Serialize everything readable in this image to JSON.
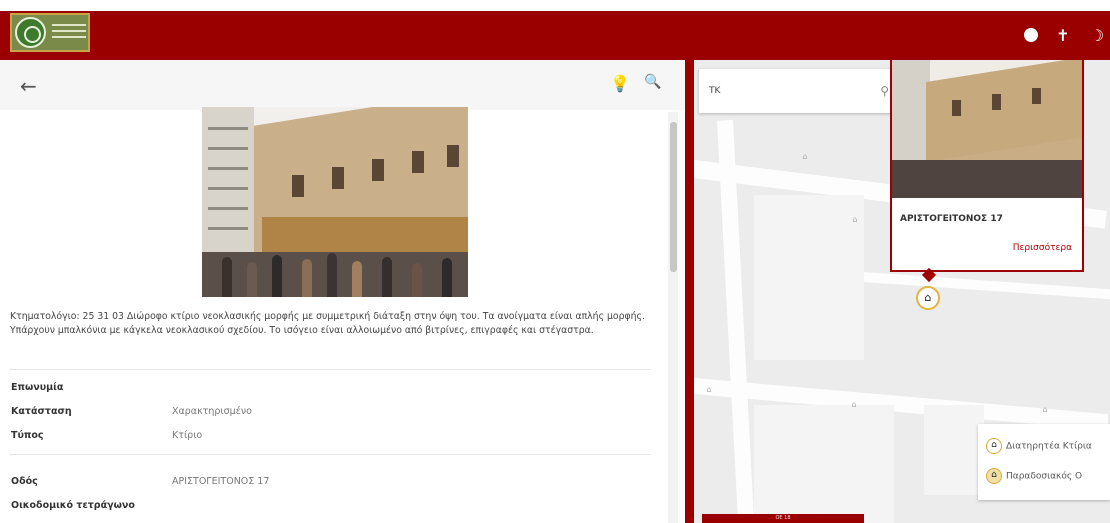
{
  "header": {
    "logo_name": "logo",
    "icons": [
      "info-icon",
      "pin-icon",
      "theme-toggle-icon"
    ],
    "brand_color": "#9b0000"
  },
  "left_panel": {
    "back_icon": "back-arrow-icon",
    "toolbar_icons": [
      "lightbulb-icon",
      "zoom-icon"
    ],
    "description": "Κτηματολόγιο: 25 31 03 Διώροφο κτίριο νεοκλασικής μορφής με συμμετρική διάταξη στην όψη του. Τα ανοίγματα είναι απλής μορφής. Υπάρχουν μπαλκόνια με κάγκελα νεοκλασικού σχεδίου. Το ισόγειο είναι αλλοιωμένο από βιτρίνες, επιγραφές και στέγαστρα.",
    "attributes_1": [
      {
        "label": "Επωνυμία",
        "value": ""
      },
      {
        "label": "Κατάσταση",
        "value": "Χαρακτηρισμένο"
      },
      {
        "label": "Τύπος",
        "value": "Κτίριο"
      }
    ],
    "attributes_2": [
      {
        "label": "Οδός",
        "value": "ΑΡΙΣΤΟΓΕΙΤΟΝΟΣ 17"
      },
      {
        "label": "Οικοδομικό τετράγωνο",
        "value": ""
      }
    ]
  },
  "map": {
    "search_value": "ΤΚ",
    "popup_title": "ΑΡΙΣΤΟΓΕΙΤΟΝΟΣ 17",
    "popup_more": "Περισσότερα",
    "legend": [
      {
        "icon": "house-icon",
        "label": "Διατηρητέα Κτίρια"
      },
      {
        "icon": "shop-icon",
        "label": "Παραδοσιακός Ο"
      }
    ],
    "bottom_tab": "ΟΕ 18"
  }
}
